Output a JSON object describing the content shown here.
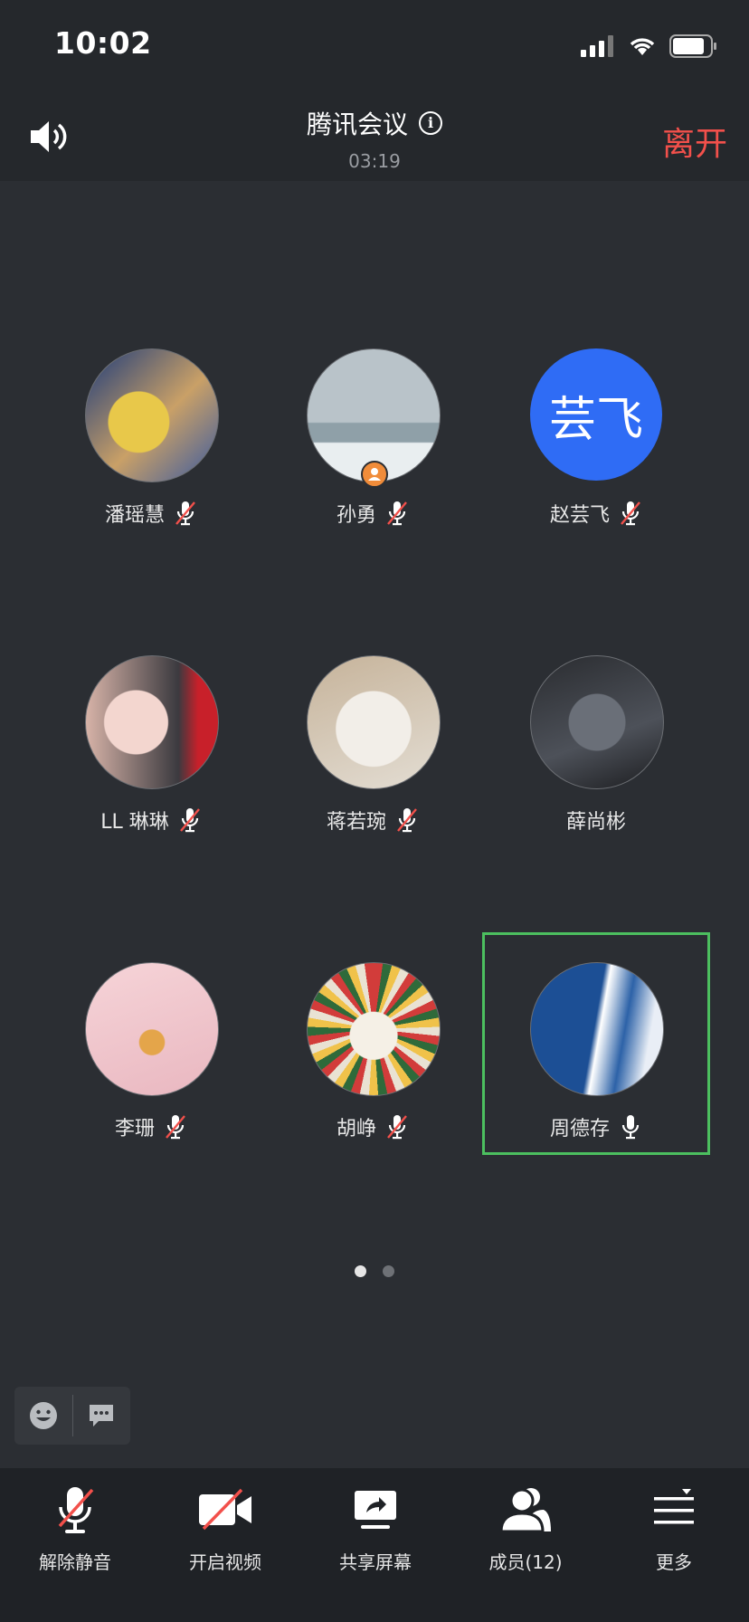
{
  "status": {
    "time": "10:02"
  },
  "header": {
    "title": "腾讯会议",
    "timer": "03:19",
    "leave": "离开"
  },
  "participants": [
    {
      "name": "潘瑶慧",
      "muted": true
    },
    {
      "name": "孙勇",
      "muted": true
    },
    {
      "name": "赵芸飞",
      "muted": true,
      "initials": "芸飞",
      "color": "#2f6cf5"
    },
    {
      "name": "LL 琳琳",
      "muted": true
    },
    {
      "name": "蒋若琬",
      "muted": true
    },
    {
      "name": "薛尚彬",
      "muted": null
    },
    {
      "name": "李珊",
      "muted": true
    },
    {
      "name": "胡峥",
      "muted": true
    },
    {
      "name": "周德存",
      "muted": false,
      "active": true
    }
  ],
  "pager": {
    "pages": 2,
    "current": 1
  },
  "toolbar": {
    "unmute": "解除静音",
    "video": "开启视频",
    "share": "共享屏幕",
    "members": "成员(12)",
    "more": "更多"
  },
  "colors": {
    "accent_leave": "#f2504b",
    "active_border": "#4cbf5f",
    "avatar_blue": "#2f6cf5"
  }
}
